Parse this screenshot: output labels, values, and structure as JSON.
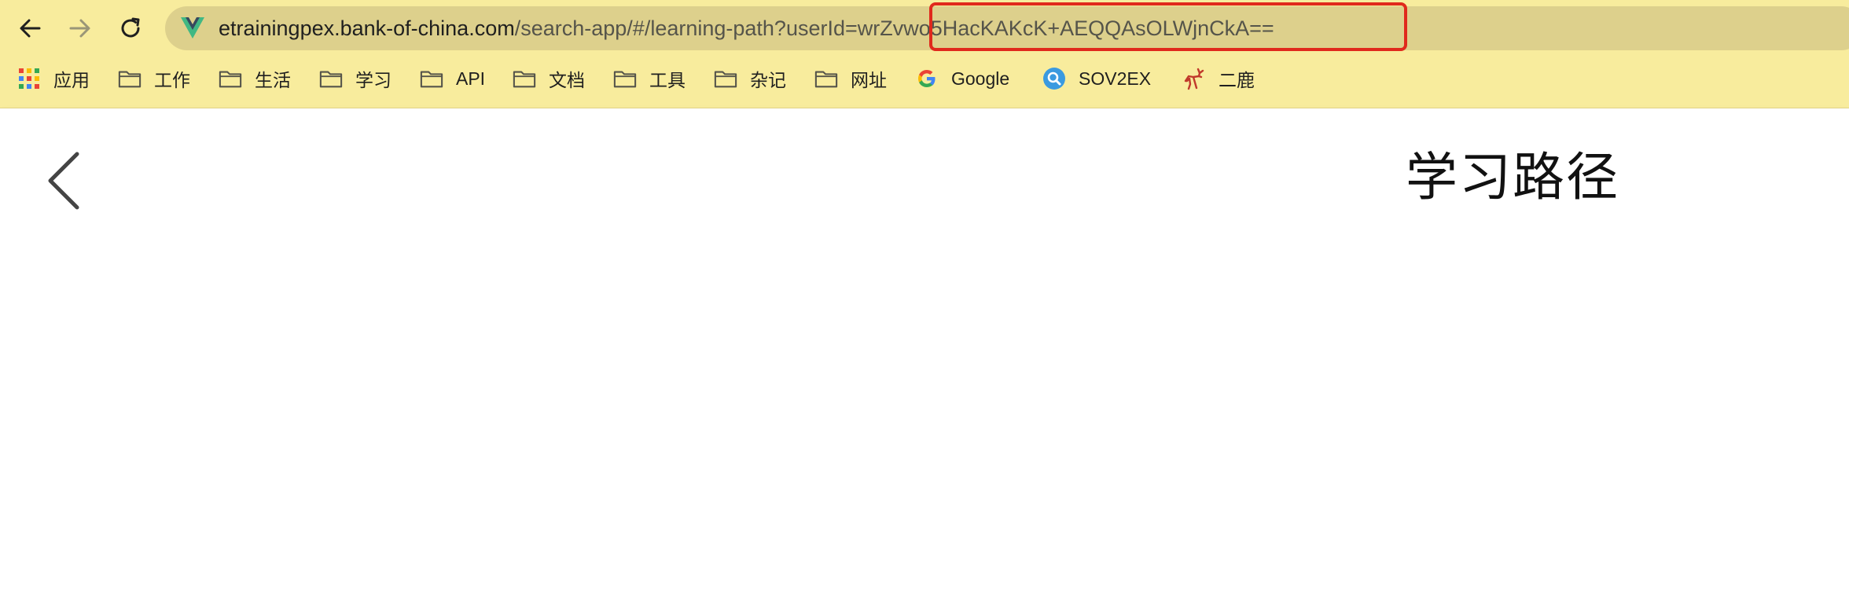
{
  "browser": {
    "url": {
      "domain": "etrainingpex.bank-of-china.com",
      "path": "/search-app/#/learning-path?userId=",
      "user_id": "wrZvwo5HacKAKcK+AEQQAsOLWjnCkA=="
    },
    "bookmarks": [
      {
        "label": "应用",
        "icon": "apps-grid-icon"
      },
      {
        "label": "工作",
        "icon": "folder-icon"
      },
      {
        "label": "生活",
        "icon": "folder-icon"
      },
      {
        "label": "学习",
        "icon": "folder-icon"
      },
      {
        "label": "API",
        "icon": "folder-icon"
      },
      {
        "label": "文档",
        "icon": "folder-icon"
      },
      {
        "label": "工具",
        "icon": "folder-icon"
      },
      {
        "label": "杂记",
        "icon": "folder-icon"
      },
      {
        "label": "网址",
        "icon": "folder-icon"
      },
      {
        "label": "Google",
        "icon": "google-icon"
      },
      {
        "label": "SOV2EX",
        "icon": "search-badge-icon"
      },
      {
        "label": "二鹿",
        "icon": "deer-icon"
      }
    ],
    "colors": {
      "chrome_background": "#f8ec9d",
      "address_bar": "#ddd08c",
      "highlight_border": "#e0291c"
    }
  },
  "page": {
    "title": "学习路径"
  }
}
